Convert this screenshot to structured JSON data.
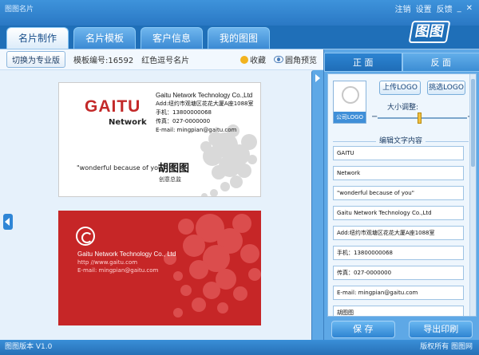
{
  "app": {
    "title": "图图名片"
  },
  "topbar": {
    "login": "注销",
    "settings": "设置",
    "feedback": "反馈",
    "minimize": "_",
    "close": "✕"
  },
  "logo": {
    "text": "图图"
  },
  "tabs": [
    {
      "label": "名片制作"
    },
    {
      "label": "名片模板"
    },
    {
      "label": "客户信息"
    },
    {
      "label": "我的图图"
    }
  ],
  "toolbar": {
    "pro_button": "切换为专业版",
    "template_no": "模板编号:16592",
    "template_name": "红色逗号名片",
    "favorite": "收藏",
    "round_preview": "圆角预览"
  },
  "card_front": {
    "brand": "GAITU",
    "brand_sub": "Network",
    "company": "Gaitu Network Technology Co.,Ltd",
    "address": "Add:纽约市观塘区花花大厦A座1088室",
    "mobile": "手机：13800000068",
    "fax": "传真：027-0000000",
    "email": "E-mail: mingpian@gaitu.com",
    "slogan": "\"wonderful because of you\"",
    "name": "胡图图",
    "title": "创意总监"
  },
  "card_back": {
    "company": "Gaitu Network Technology Co., Ltd",
    "website": "http //www.gaitu.com",
    "email": "E-mail: mingpian@gaitu.com"
  },
  "side": {
    "tab_front": "正 面",
    "tab_back": "反 面",
    "logo_label": "公司LOGO",
    "upload_logo": "上传LOGO",
    "pick_logo": "挑选LOGO",
    "size_adjust": "大小调整:",
    "minus": "−",
    "plus": "+",
    "edit_text": "编辑文字内容",
    "fields": [
      "GAITU",
      "Network",
      "\"wonderful because of you\"",
      "Gaitu Network Technology Co.,Ltd",
      "Add:纽约市观塘区花花大厦A座1088室",
      "手机：13800000068",
      "传真：027-0000000",
      "E-mail: mingpian@gaitu.com",
      "胡图图"
    ],
    "save": "保 存",
    "export": "导出印刷"
  },
  "status": {
    "version": "图图版本 V1.0",
    "copyright": "版权所有 图图网"
  }
}
